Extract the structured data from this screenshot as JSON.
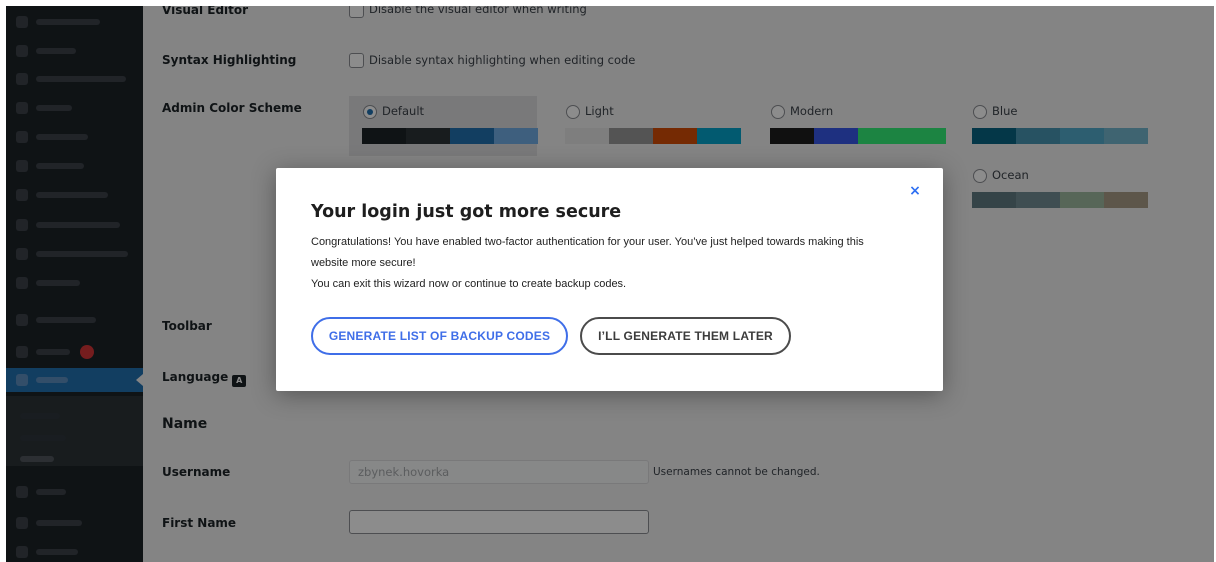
{
  "form": {
    "visual_editor": {
      "label": "Visual Editor",
      "checkbox_text": "Disable the visual editor when writing"
    },
    "syntax_highlighting": {
      "label": "Syntax Highlighting",
      "checkbox_text": "Disable syntax highlighting when editing code"
    },
    "color_scheme": {
      "label": "Admin Color Scheme",
      "schemes": [
        {
          "name": "Default",
          "selected": true,
          "colors": [
            "#1d2327",
            "#2c3338",
            "#2271b1",
            "#72aee6"
          ]
        },
        {
          "name": "Light",
          "selected": false,
          "colors": [
            "#e5e5e5",
            "#999999",
            "#d64e07",
            "#04a4cc"
          ]
        },
        {
          "name": "Modern",
          "selected": false,
          "colors": [
            "#1e1e1e",
            "#3858e9",
            "#33f078",
            "#33f078"
          ]
        },
        {
          "name": "Blue",
          "selected": false,
          "colors": [
            "#096484",
            "#4796b3",
            "#52accc",
            "#74b6ce"
          ]
        },
        {
          "name": "Ocean",
          "selected": false,
          "colors": [
            "#627c83",
            "#738e96",
            "#9ebaa0",
            "#aa9d88"
          ]
        }
      ]
    },
    "toolbar": {
      "label": "Toolbar"
    },
    "language": {
      "label": "Language"
    },
    "name_section": {
      "title": "Name"
    },
    "username": {
      "label": "Username",
      "value": "zbynek.hovorka",
      "hint": "Usernames cannot be changed."
    },
    "first_name": {
      "label": "First Name",
      "value": ""
    }
  },
  "modal": {
    "close_label": "×",
    "title": "Your login just got more secure",
    "paragraph1": "Congratulations! You have enabled two-factor authentication for your user. You’ve just helped towards making this website more secure!",
    "paragraph2": "You can exit this wizard now or continue to create backup codes.",
    "primary_button": "GENERATE LIST OF BACKUP CODES",
    "secondary_button": "I’LL GENERATE THEM LATER",
    "colors": {
      "primary": "#3f6ee8",
      "secondary": "#4b4b4b",
      "close": "#2e6ff2"
    }
  },
  "icons": {
    "language": "translation-icon",
    "close": "close-icon"
  }
}
